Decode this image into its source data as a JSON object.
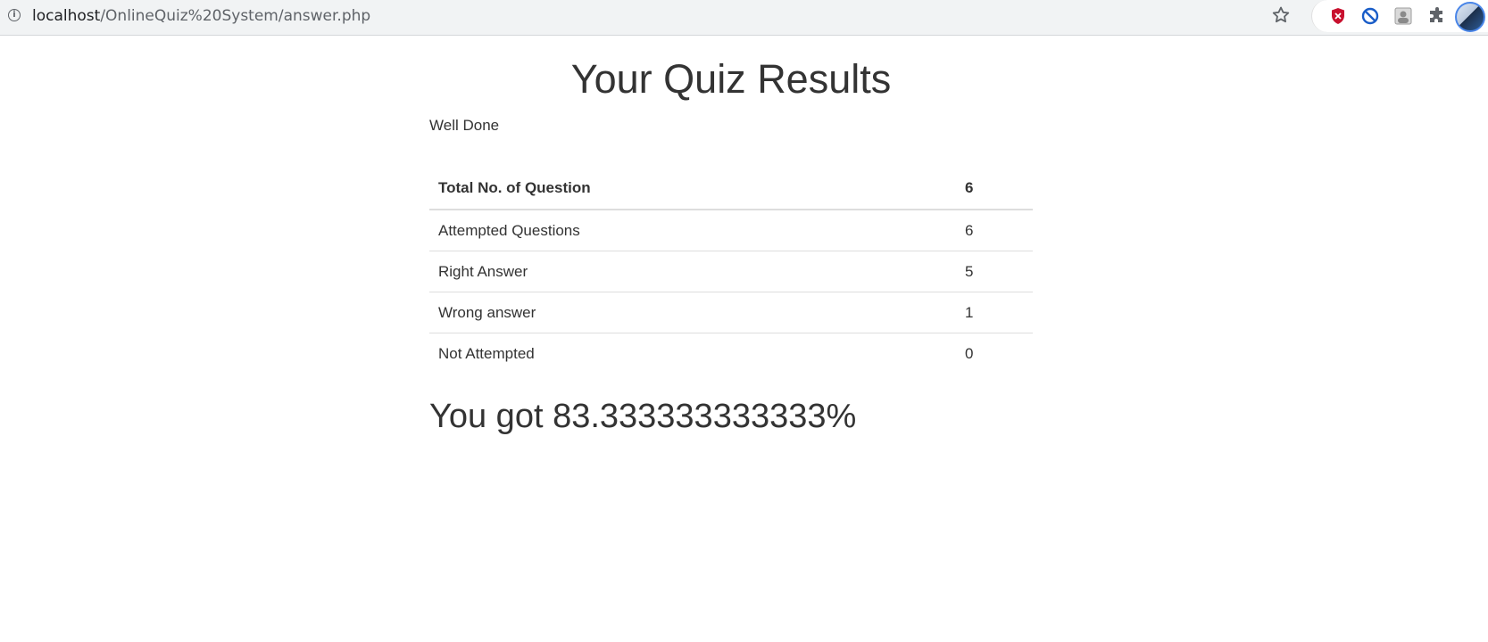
{
  "browser": {
    "url_host": "localhost",
    "url_path": "/OnlineQuiz%20System/answer.php",
    "icons": [
      "info-icon",
      "bookmark-star-icon",
      "ublock-shield-icon",
      "block-icon",
      "extension-image-icon",
      "extensions-puzzle-icon",
      "profile-avatar"
    ]
  },
  "page": {
    "title": "Your Quiz Results",
    "message": "Well Done",
    "table": {
      "rows": [
        {
          "label": "Total No. of Question",
          "value": "6"
        },
        {
          "label": "Attempted Questions",
          "value": "6"
        },
        {
          "label": "Right Answer",
          "value": "5"
        },
        {
          "label": "Wrong answer",
          "value": "1"
        },
        {
          "label": "Not Attempted",
          "value": "0"
        }
      ]
    },
    "score_text": "You got 83.333333333333%"
  },
  "colors": {
    "text": "#333333",
    "rule": "#dddddd",
    "toolbar": "#f1f3f4",
    "avatar_ring": "#4a86e8"
  }
}
